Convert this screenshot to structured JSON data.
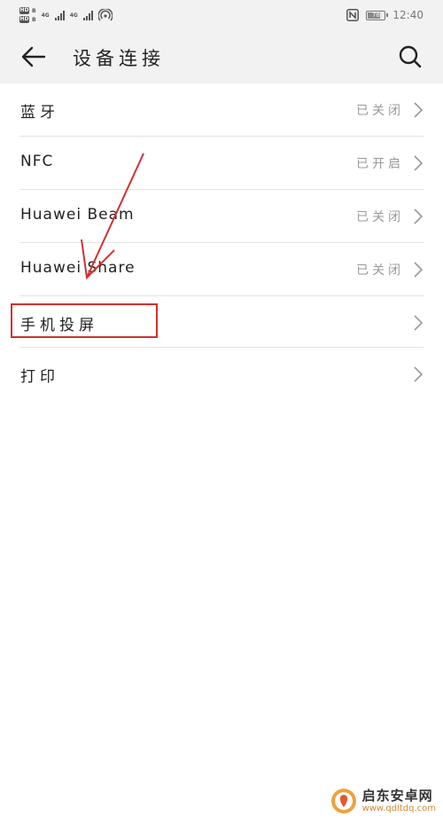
{
  "status_bar": {
    "hd_label": "HD",
    "hd_sub": "B",
    "network_1": "4G",
    "network_2": "4G",
    "battery_level": "78",
    "time": "12:40",
    "icons": [
      "hd-icon",
      "signal-icon",
      "wifi-hotspot-icon",
      "nfc-icon",
      "battery-icon"
    ]
  },
  "app_bar": {
    "title": "设备连接",
    "back_icon": "arrow-left-icon",
    "search_icon": "search-icon"
  },
  "items": [
    {
      "label": "蓝牙",
      "status": "已关闭"
    },
    {
      "label": "NFC",
      "status": "已开启"
    },
    {
      "label": "Huawei Beam",
      "status": "已关闭"
    },
    {
      "label": "Huawei Share",
      "status": "已关闭"
    },
    {
      "label": "手机投屏",
      "status": ""
    },
    {
      "label": "打印",
      "status": ""
    }
  ],
  "annotation": {
    "color": "#d3302f",
    "highlighted_item": "手机投屏"
  },
  "watermark": {
    "name": "启东安卓网",
    "url": "www.qdltdq.com"
  }
}
